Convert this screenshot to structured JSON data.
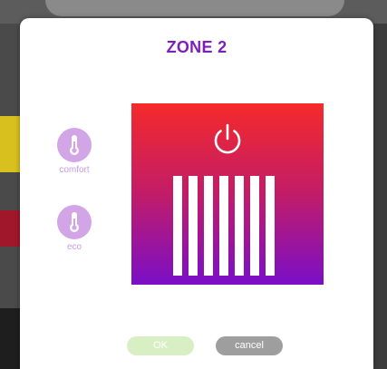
{
  "modal": {
    "title": "ZONE 2"
  },
  "modes": [
    {
      "label": "comfort",
      "icon": "thermometer-icon"
    },
    {
      "label": "eco",
      "icon": "thermometer-icon"
    }
  ],
  "heater": {
    "icon": "power-icon",
    "fins": 7,
    "gradient_top": "#f52a2a",
    "gradient_bottom": "#7a0fc7"
  },
  "buttons": {
    "ok_label": "OK",
    "cancel_label": "cancel"
  },
  "colors": {
    "accent": "#7d1fb8",
    "mode_circle": "#d2a6e6",
    "ok_button": "#d8efc3",
    "cancel_button": "#9e9e9e"
  }
}
